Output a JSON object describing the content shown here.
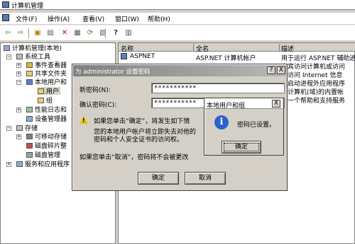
{
  "window": {
    "title": "计算机管理"
  },
  "menu": {
    "items": [
      "文件(F)",
      "操作(A)",
      "查看(V)",
      "窗口(W)",
      "帮助(H)"
    ]
  },
  "toolbar": {
    "icons": [
      "back-icon",
      "forward-icon",
      "up-icon",
      "show-tree-icon",
      "delete-icon",
      "properties-icon",
      "refresh-icon",
      "export-icon",
      "help-icon",
      "view-icon"
    ]
  },
  "tree": {
    "root": "计算机管理(本地)",
    "system_tools": "系统工具",
    "event_viewer": "事件查看器",
    "shared_folders": "共享文件夹",
    "local_users_groups": "本地用户和",
    "users": "用户",
    "groups": "组",
    "perf_logs": "性能日志和",
    "device_manager": "设备管理器",
    "storage": "存储",
    "removable_storage": "可移动存储",
    "defrag": "磁盘碎片整",
    "disk_mgmt": "磁盘管理",
    "services_apps": "服务和应用程序"
  },
  "list": {
    "columns": [
      "名称",
      "全名",
      "描述"
    ],
    "rows": [
      {
        "name": "ASPNET",
        "fullname": "ASP.NET 计算机帐户",
        "desc": "用于运行 ASP.NET 辅助进"
      },
      {
        "name": "",
        "fullname": "",
        "desc": "来宾访问计算机或访问"
      },
      {
        "name": "",
        "fullname": "",
        "desc": "名访问 Internet 信息"
      },
      {
        "name": "",
        "fullname": "",
        "desc": "于启动进程外应用程序"
      },
      {
        "name": "",
        "fullname": "",
        "desc": "理计算机(域)的内置帐"
      },
      {
        "name": "",
        "fullname": "",
        "desc": "是一个帮助和支持服务"
      }
    ]
  },
  "set_password_dialog": {
    "title": "为 administrator 设置密码",
    "help_btn": "?",
    "close_btn": "X",
    "new_password_label": "新密码(N):",
    "new_password_value": "***********",
    "confirm_password_label": "确认密码(C):",
    "confirm_password_value": "***********",
    "warning_line1": "如果您单击“确定”，将发生如下情",
    "warning_line2": "您的本地用户帐户将立即失去对他的",
    "warning_line3": "密码和个人安全证书的访问权。",
    "cancel_note": "如果您单击“取消”，密码将不会被更改",
    "ok_label": "确定",
    "cancel_label": "取消"
  },
  "message_box": {
    "title": "本地用户和组",
    "close_btn": "X",
    "message": "密码已设置。",
    "ok_label": "确定"
  },
  "colors": {
    "info_icon": "#2e62c8",
    "warning_icon": "#e8c000",
    "dialog_bg": "#d4d0c8"
  }
}
